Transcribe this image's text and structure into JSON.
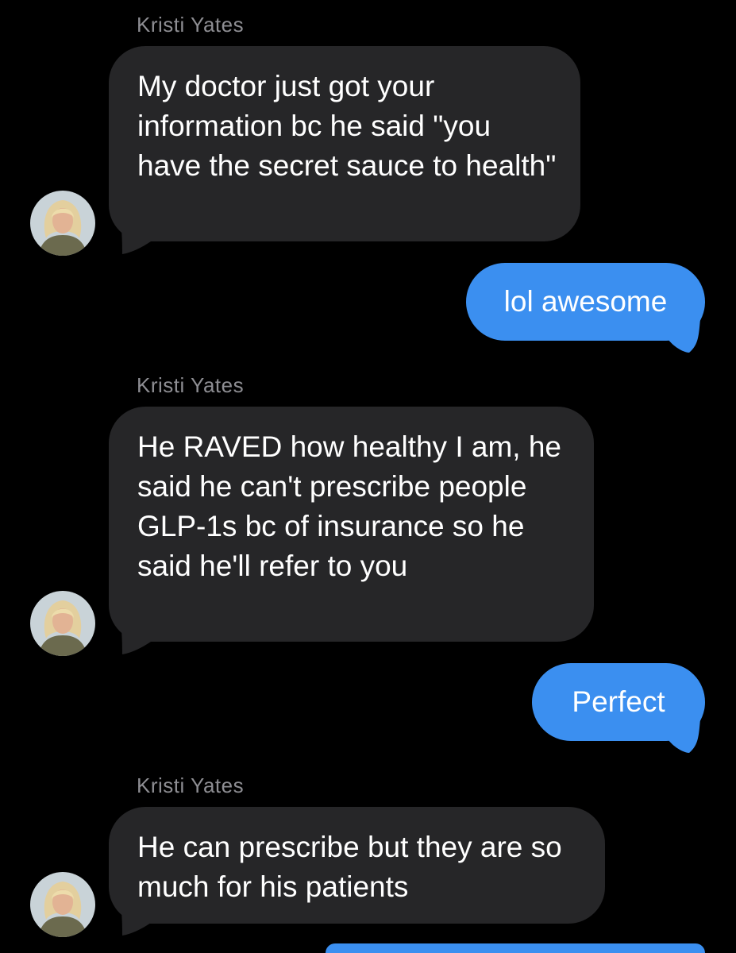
{
  "conversation": {
    "contact_name": "Kristi  Yates",
    "messages": [
      {
        "direction": "incoming",
        "sender": "Kristi  Yates",
        "text": "My doctor just got your information bc he said \"you have the secret sauce to health\""
      },
      {
        "direction": "outgoing",
        "text": "lol awesome"
      },
      {
        "direction": "incoming",
        "sender": "Kristi  Yates",
        "text": "He RAVED how healthy I am, he said he can't prescribe people GLP-1s bc of insurance so he said he'll refer to you"
      },
      {
        "direction": "outgoing",
        "text": "Perfect"
      },
      {
        "direction": "incoming",
        "sender": "Kristi  Yates",
        "text": "He can prescribe but they are so much for his patients"
      }
    ]
  },
  "colors": {
    "background": "#000000",
    "incoming_bubble": "#262628",
    "outgoing_bubble": "#3b8ff0",
    "sender_label": "#8e8e93",
    "text": "#ffffff"
  }
}
